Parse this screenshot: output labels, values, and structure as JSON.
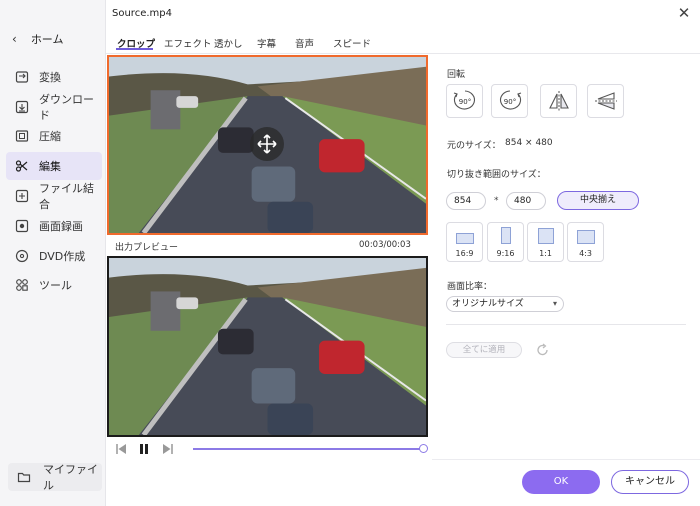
{
  "window": {
    "title": "Source.mp4"
  },
  "sidebar": {
    "home_label": "ホーム",
    "items": [
      {
        "label": "変換",
        "icon": "convert-icon"
      },
      {
        "label": "ダウンロード",
        "icon": "download-icon"
      },
      {
        "label": "圧縮",
        "icon": "compress-icon"
      },
      {
        "label": "編集",
        "icon": "scissors-icon",
        "active": true
      },
      {
        "label": "ファイル結合",
        "icon": "merge-icon"
      },
      {
        "label": "画面録画",
        "icon": "screen-record-icon"
      },
      {
        "label": "DVD作成",
        "icon": "dvd-icon"
      },
      {
        "label": "ツール",
        "icon": "tools-icon"
      }
    ],
    "my_files_label": "マイファイル"
  },
  "tabs": [
    "クロップ",
    "エフェクト",
    "透かし",
    "字幕",
    "音声",
    "スピード"
  ],
  "preview": {
    "output_label": "出力プレビュー",
    "time": "00:03/00:03",
    "progress": 1.0
  },
  "panel": {
    "rotate_label": "回転",
    "rotate_left_text": "90°",
    "rotate_right_text": "90°",
    "original_size_label": "元のサイズ：",
    "original_size_value": "854 × 480",
    "crop_size_label": "切り抜き範囲のサイズ：",
    "width_value": "854",
    "height_value": "480",
    "times_sign": "*",
    "center_button": "中央揃え",
    "ratios": [
      "16:9",
      "9:16",
      "1:1",
      "4:3"
    ],
    "aspect_label": "画面比率：",
    "aspect_selected": "オリジナルサイズ",
    "apply_all": "全てに適用"
  },
  "footer": {
    "ok": "OK",
    "cancel": "キャンセル"
  },
  "colors": {
    "accent": "#8c6bf0",
    "crop_border": "#f06a2d"
  }
}
